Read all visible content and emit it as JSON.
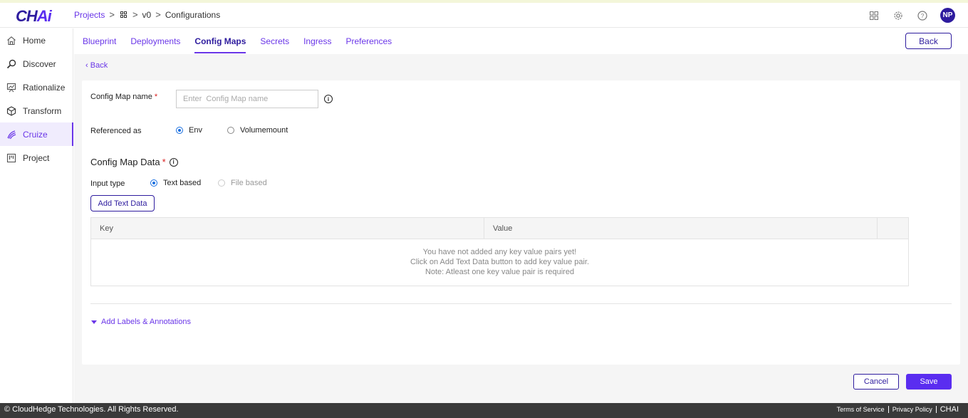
{
  "app": {
    "logo_prefix": "CH",
    "logo_suffix": "Ai"
  },
  "breadcrumb": {
    "projects": "Projects",
    "sep": ">",
    "version": "v0",
    "current": "Configurations"
  },
  "header": {
    "avatar_initials": "NP"
  },
  "sidebar": {
    "items": [
      {
        "label": "Home",
        "icon": "home-icon"
      },
      {
        "label": "Discover",
        "icon": "discover-icon"
      },
      {
        "label": "Rationalize",
        "icon": "rationalize-icon"
      },
      {
        "label": "Transform",
        "icon": "cube-icon"
      },
      {
        "label": "Cruize",
        "icon": "cruize-icon",
        "active": true
      },
      {
        "label": "Project",
        "icon": "project-icon"
      }
    ]
  },
  "tabs": {
    "items": [
      "Blueprint",
      "Deployments",
      "Config Maps",
      "Secrets",
      "Ingress",
      "Preferences"
    ],
    "active": "Config Maps",
    "back_label": "Back"
  },
  "form": {
    "back_link": "Back",
    "name_label": "Config Map name",
    "required_mark": "*",
    "name_placeholder": "Enter  Config Map name",
    "name_value": "",
    "referenced_label": "Referenced as",
    "ref_options": [
      "Env",
      "Volumemount"
    ],
    "ref_selected": "Env",
    "data_title": "Config Map Data",
    "input_type_label": "Input type",
    "input_options": [
      "Text based",
      "File based"
    ],
    "input_selected": "Text based",
    "add_text_label": "Add Text Data",
    "table": {
      "columns": [
        "Key",
        "Value"
      ],
      "empty_lines": [
        "You have not added any key value pairs yet!",
        "Click on Add Text Data button to add key value pair.",
        "Note: Atleast one key value pair is required"
      ]
    },
    "labels_toggle": "Add Labels & Annotations",
    "cancel_label": "Cancel",
    "save_label": "Save"
  },
  "footer": {
    "copyright": "© CloudHedge Technologies. All Rights Reserved.",
    "links": [
      "Terms of Service",
      "Privacy Policy",
      "CHAI"
    ]
  },
  "colors": {
    "primary": "#6a36e8",
    "brand_dark": "#2e1c9e",
    "save_bg": "#5a2df0",
    "footer_bg": "#3a3a3a"
  }
}
